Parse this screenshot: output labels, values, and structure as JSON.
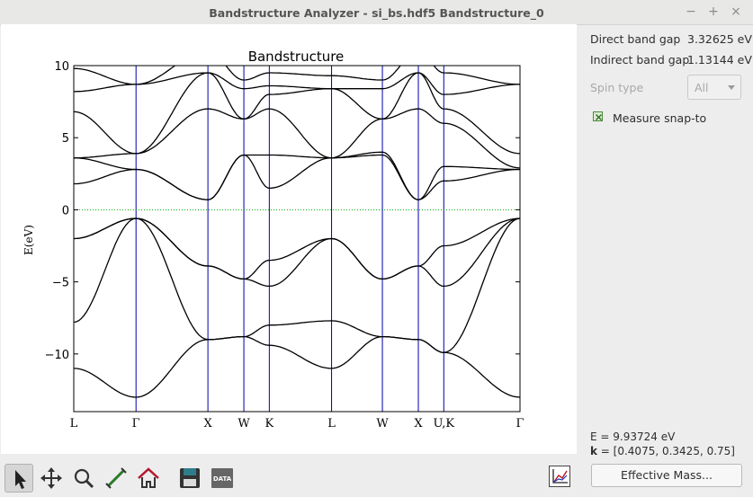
{
  "window": {
    "title": "Bandstructure Analyzer - si_bs.hdf5 Bandstructure_0"
  },
  "plot": {
    "title": "Bandstructure",
    "ylabel": "E(eV)",
    "yticks": [
      "10",
      "5",
      "0",
      "−5",
      "−10"
    ],
    "kpoint_labels": [
      "L",
      "Γ",
      "X",
      "W",
      "K",
      "L",
      "W",
      "X",
      "U,K",
      "Γ"
    ]
  },
  "chart_data": {
    "type": "line",
    "title": "Bandstructure",
    "ylabel": "E(eV)",
    "ylim": [
      -14,
      10
    ],
    "yticks": [
      10,
      5,
      0,
      -5,
      -10
    ],
    "x_ticks": [
      "L",
      "Γ",
      "X",
      "W",
      "K",
      "L",
      "W",
      "X",
      "U,K",
      "Γ"
    ],
    "x_tick_positions": [
      0,
      0.866,
      1.866,
      2.366,
      2.72,
      3.586,
      4.293,
      4.793,
      5.147,
      6.207
    ],
    "fermi_level": 0,
    "series": [
      {
        "values_at_ticks": [
          -11.0,
          -13.0,
          -9.0,
          -8.8,
          -9.4,
          -11.0,
          -8.8,
          -9.0,
          -9.9,
          -13.0
        ]
      },
      {
        "values_at_ticks": [
          -7.8,
          -0.6,
          -9.0,
          -8.8,
          -8.0,
          -7.7,
          -8.8,
          -9.0,
          -9.9,
          -0.6
        ]
      },
      {
        "values_at_ticks": [
          -2.0,
          -0.6,
          -3.9,
          -4.8,
          -5.3,
          -2.0,
          -4.8,
          -3.9,
          -5.3,
          -0.6
        ]
      },
      {
        "values_at_ticks": [
          -2.0,
          -0.6,
          -3.9,
          -4.8,
          -3.5,
          -2.0,
          -4.8,
          -3.9,
          -2.5,
          -0.6
        ]
      },
      {
        "values_at_ticks": [
          1.8,
          2.8,
          0.7,
          3.8,
          1.5,
          3.6,
          3.8,
          0.7,
          2.0,
          2.8
        ]
      },
      {
        "values_at_ticks": [
          3.6,
          2.8,
          0.7,
          3.8,
          3.8,
          3.6,
          4.0,
          0.7,
          3.0,
          2.8
        ]
      },
      {
        "values_at_ticks": [
          3.6,
          3.9,
          7.0,
          6.3,
          7.0,
          3.6,
          6.3,
          7.0,
          6.0,
          2.9
        ]
      },
      {
        "values_at_ticks": [
          6.8,
          3.9,
          9.5,
          6.3,
          8.0,
          8.4,
          6.3,
          9.5,
          7.0,
          3.9
        ]
      },
      {
        "values_at_ticks": [
          8.2,
          8.7,
          9.5,
          8.4,
          8.6,
          8.4,
          8.4,
          9.5,
          8.0,
          8.7
        ]
      },
      {
        "values_at_ticks": [
          9.8,
          8.7,
          11.0,
          9.0,
          9.5,
          9.3,
          9.0,
          11.0,
          9.5,
          8.7
        ]
      }
    ]
  },
  "info": {
    "direct_label": "Direct band gap",
    "direct_value": "3.32625 eV",
    "indirect_label": "Indirect band gap",
    "indirect_value": "1.13144 eV",
    "spin_label": "Spin type",
    "spin_value": "All",
    "snap_label": "Measure snap-to"
  },
  "status": {
    "energy": "E = 9.93724 eV",
    "k_label": "k",
    "k_value": " = [0.4075, 0.3425, 0.75]"
  },
  "toolbar": {
    "icons": [
      "pointer-icon",
      "pan-icon",
      "zoom-icon",
      "measure-icon",
      "home-icon",
      "save-icon",
      "data-icon"
    ],
    "data_label": "DATA",
    "effective_mass_label": "Effective Mass..."
  },
  "colors": {
    "band": "#000000",
    "kline": "#0000aa",
    "fermi": "#00aa00"
  }
}
